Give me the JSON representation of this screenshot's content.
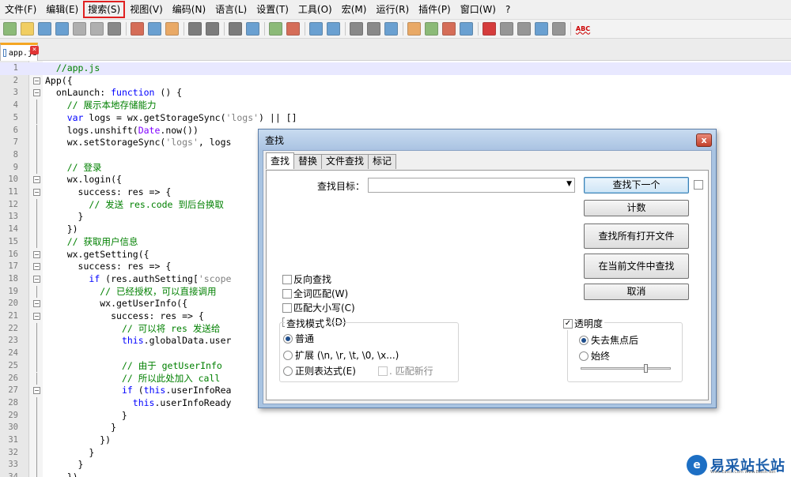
{
  "menubar": {
    "items": [
      "文件(F)",
      "编辑(E)",
      "搜索(S)",
      "视图(V)",
      "编码(N)",
      "语言(L)",
      "设置(T)",
      "工具(O)",
      "宏(M)",
      "运行(R)",
      "插件(P)",
      "窗口(W)",
      "?"
    ]
  },
  "toolbar": {
    "icons": [
      "new-file-icon",
      "open-file-icon",
      "save-icon",
      "save-all-icon",
      "close-icon",
      "close-all-icon",
      "print-icon",
      "sep",
      "cut-icon",
      "copy-icon",
      "paste-icon",
      "sep",
      "undo-icon",
      "redo-icon",
      "sep",
      "find-icon",
      "replace-icon",
      "sep",
      "zoom-in-icon",
      "zoom-out-icon",
      "sep",
      "sync-vertical-icon",
      "sync-horizontal-icon",
      "sep",
      "word-wrap-icon",
      "show-all-chars-icon",
      "indent-guide-icon",
      "sep",
      "doc-map-icon",
      "function-list-icon",
      "folder-workspace-icon",
      "monitor-icon",
      "sep",
      "record-macro-icon",
      "stop-macro-icon",
      "play-macro-icon",
      "run-macro-multiple-icon",
      "save-macro-icon",
      "sep",
      "spell-check-icon"
    ],
    "spellcheck_label": "ABC"
  },
  "tab": {
    "name": "app.js",
    "close": "×"
  },
  "editor": {
    "lines": [
      {
        "n": "1",
        "html": "  <span class=\"c-cmt\">//app.js</span>"
      },
      {
        "n": "2",
        "html": "App({"
      },
      {
        "n": "3",
        "html": "  onLaunch: <span class=\"c-kw\">function</span> () {"
      },
      {
        "n": "4",
        "html": "    <span class=\"c-cmt\">// 展示本地存储能力</span>"
      },
      {
        "n": "5",
        "html": "    <span class=\"c-kw\">var</span> logs = wx.getStorageSync(<span class=\"c-str\">'logs'</span>) || []"
      },
      {
        "n": "6",
        "html": "    logs.unshift(<span class=\"c-cls\">Date</span>.now())"
      },
      {
        "n": "7",
        "html": "    wx.setStorageSync(<span class=\"c-str\">'logs'</span>, logs"
      },
      {
        "n": "8",
        "html": ""
      },
      {
        "n": "9",
        "html": "    <span class=\"c-cmt\">// 登录</span>"
      },
      {
        "n": "10",
        "html": "    wx.login({"
      },
      {
        "n": "11",
        "html": "      success: res => {"
      },
      {
        "n": "12",
        "html": "        <span class=\"c-cmt\">// 发送 res.code 到后台换取</span>"
      },
      {
        "n": "13",
        "html": "      }"
      },
      {
        "n": "14",
        "html": "    })"
      },
      {
        "n": "15",
        "html": "    <span class=\"c-cmt\">// 获取用户信息</span>"
      },
      {
        "n": "16",
        "html": "    wx.getSetting({"
      },
      {
        "n": "17",
        "html": "      success: res => {"
      },
      {
        "n": "18",
        "html": "        <span class=\"c-kw\">if</span> (res.authSetting[<span class=\"c-str\">'scope</span>"
      },
      {
        "n": "19",
        "html": "          <span class=\"c-cmt\">// 已经授权，可以直接调用</span>"
      },
      {
        "n": "20",
        "html": "          wx.getUserInfo({"
      },
      {
        "n": "21",
        "html": "            success: res => {"
      },
      {
        "n": "22",
        "html": "              <span class=\"c-cmt\">// 可以将 res 发送给</span>"
      },
      {
        "n": "23",
        "html": "              <span class=\"c-kw\">this</span>.globalData.user"
      },
      {
        "n": "24",
        "html": ""
      },
      {
        "n": "25",
        "html": "              <span class=\"c-cmt\">// 由于 getUserInfo</span>"
      },
      {
        "n": "26",
        "html": "              <span class=\"c-cmt\">// 所以此处加入 call</span>"
      },
      {
        "n": "27",
        "html": "              <span class=\"c-kw\">if</span> (<span class=\"c-kw\">this</span>.userInfoRea"
      },
      {
        "n": "28",
        "html": "                <span class=\"c-kw\">this</span>.userInfoReady"
      },
      {
        "n": "29",
        "html": "              }"
      },
      {
        "n": "30",
        "html": "            }"
      },
      {
        "n": "31",
        "html": "          })"
      },
      {
        "n": "32",
        "html": "        }"
      },
      {
        "n": "33",
        "html": "      }"
      },
      {
        "n": "34",
        "html": "    })"
      }
    ]
  },
  "dialog": {
    "title": "查找",
    "close": "x",
    "tabs": [
      "查找",
      "替换",
      "文件查找",
      "标记"
    ],
    "target_label": "查找目标：",
    "target_value": "",
    "combo_arrow": "▼",
    "buttons": {
      "find_next": "查找下一个",
      "count": "计数",
      "find_all_open": "查找所有打开文件",
      "find_in_current": "在当前文件中查找",
      "cancel": "取消"
    },
    "options": [
      {
        "label": "反向查找",
        "checked": false
      },
      {
        "label": "全词匹配(W)",
        "checked": false
      },
      {
        "label": "匹配大小写(C)",
        "checked": false
      },
      {
        "label": "循环查找(D)",
        "checked": true
      }
    ],
    "mode": {
      "title": "查找模式",
      "normal": "普通",
      "extended": "扩展 (\\n, \\r, \\t, \\0, \\x...)",
      "regex": "正则表达式(E)",
      "dot_newline": ". 匹配新行",
      "selected": "normal"
    },
    "transparency": {
      "title": "透明度",
      "checked": true,
      "on_lose_focus": "失去焦点后",
      "always": "始终",
      "selected": "on_lose_focus",
      "level": 0.72
    },
    "check_mark": "✓"
  },
  "watermark": {
    "logo": "e",
    "text": "易采站长站",
    "sub": "Www.Easck.Com  Www.Easck.Net"
  }
}
